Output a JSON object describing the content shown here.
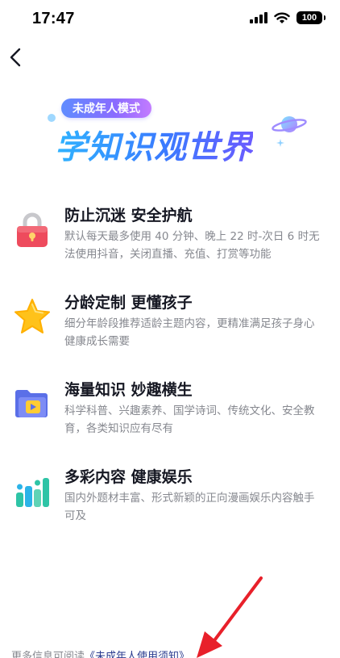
{
  "status_bar": {
    "time": "17:47",
    "battery": "100"
  },
  "hero": {
    "badge": "未成年人模式",
    "title": "学知识观世界"
  },
  "features": [
    {
      "icon": "lock-icon",
      "title": "防止沉迷 安全护航",
      "description": "默认每天最多使用 40 分钟、晚上 22 时-次日 6 时无法使用抖音，关闭直播、充值、打赏等功能"
    },
    {
      "icon": "star-icon",
      "title": "分龄定制 更懂孩子",
      "description": "细分年龄段推荐适龄主题内容，更精准满足孩子身心健康成长需要"
    },
    {
      "icon": "folder-play-icon",
      "title": "海量知识 妙趣横生",
      "description": "科学科普、兴趣素养、国学诗词、传统文化、安全教育，各类知识应有尽有"
    },
    {
      "icon": "bar-chart-icon",
      "title": "多彩内容 健康娱乐",
      "description": "国内外题材丰富、形式新颖的正向漫画娱乐内容触手可及"
    }
  ],
  "footer": {
    "prefix": "更多信息可阅读",
    "link": "《未成年人使用须知》"
  },
  "colors": {
    "accent": "#3a7bff",
    "arrow": "#e8202a",
    "text_primary": "#161823",
    "text_secondary": "#86888f"
  }
}
